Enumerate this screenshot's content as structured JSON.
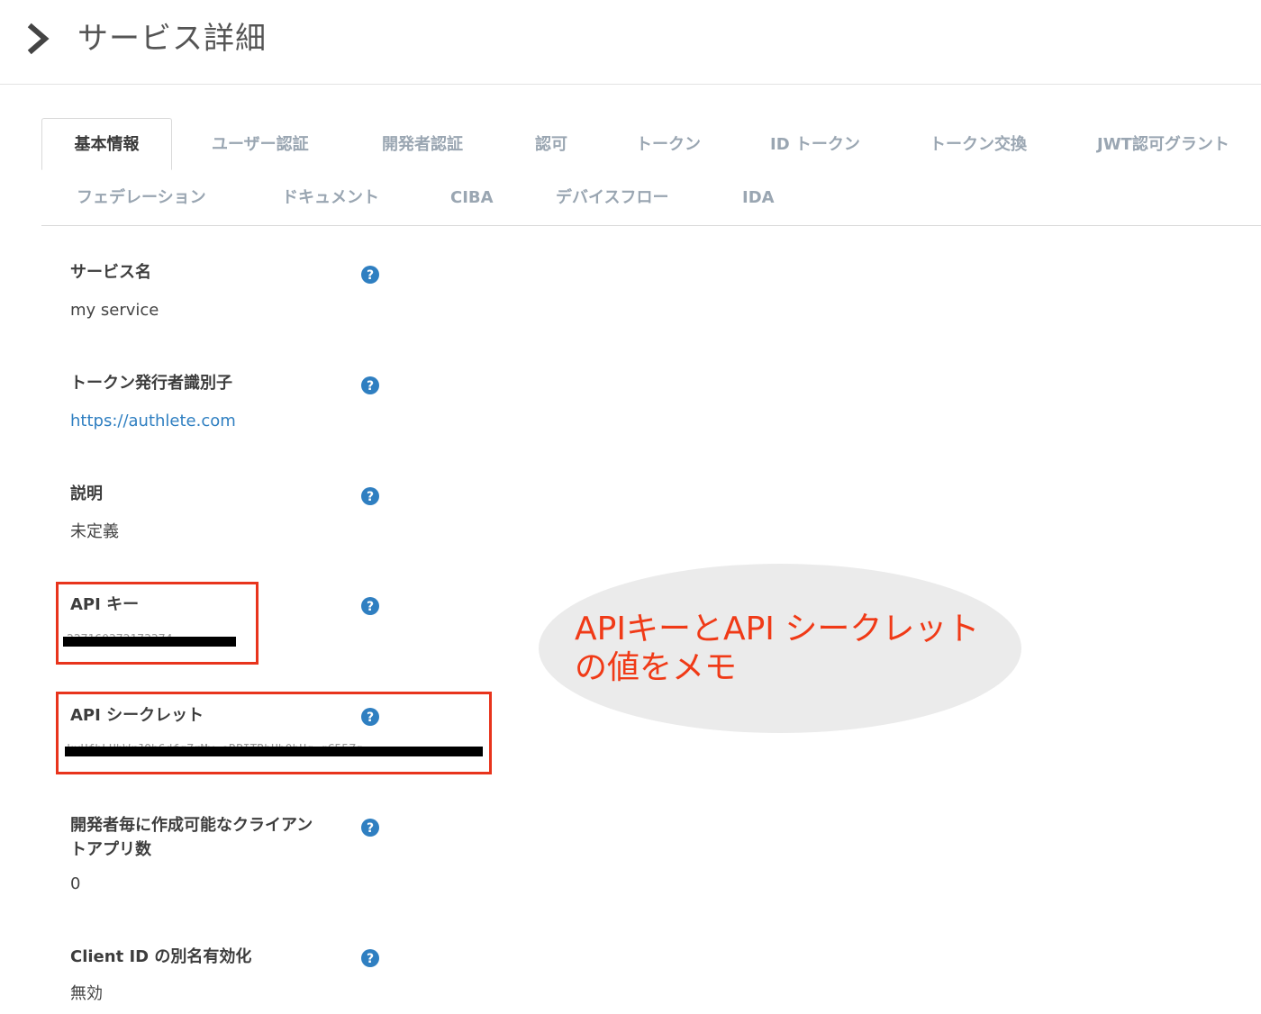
{
  "header": {
    "title": "サービス詳細",
    "icon": "chevron-right-icon"
  },
  "tabs": [
    {
      "label": "基本情報",
      "active": true
    },
    {
      "label": "ユーザー認証",
      "active": false
    },
    {
      "label": "開発者認証",
      "active": false
    },
    {
      "label": "認可",
      "active": false
    },
    {
      "label": "トークン",
      "active": false
    },
    {
      "label": "ID トークン",
      "active": false
    },
    {
      "label": "トークン交換",
      "active": false
    },
    {
      "label": "JWT認可グラント",
      "active": false
    },
    {
      "label": "フェデレーション",
      "active": false
    },
    {
      "label": "ドキュメント",
      "active": false
    },
    {
      "label": "CIBA",
      "active": false
    },
    {
      "label": "デバイスフロー",
      "active": false
    },
    {
      "label": "IDA",
      "active": false
    }
  ],
  "fields": [
    {
      "label": "サービス名",
      "value": "my service"
    },
    {
      "label": "トークン発行者識別子",
      "value": "https://authlete.com"
    },
    {
      "label": "説明",
      "value": "未定義"
    },
    {
      "label": "API キー",
      "value": "227160372173374"
    },
    {
      "label": "API シークレット",
      "value": "kxHfhLHhWrJOh6dfgZrMy_oRPITRbUb0bHq_gC55Zg"
    },
    {
      "label_line1": "開発者毎に作成可能なクライアン",
      "label_line2": "トアプリ数",
      "value": "0"
    },
    {
      "label": "Client ID の別名有効化",
      "value": "無効"
    }
  ],
  "callout": {
    "line1": "APIキーとAPI シークレット",
    "line2": "の値をメモ"
  },
  "colors": {
    "highlight": "#e8341c",
    "callout_text": "#f03a17",
    "link": "#2f7fc1",
    "help_icon": "#2f7fc1",
    "tab_inactive": "#9aa6b2"
  }
}
